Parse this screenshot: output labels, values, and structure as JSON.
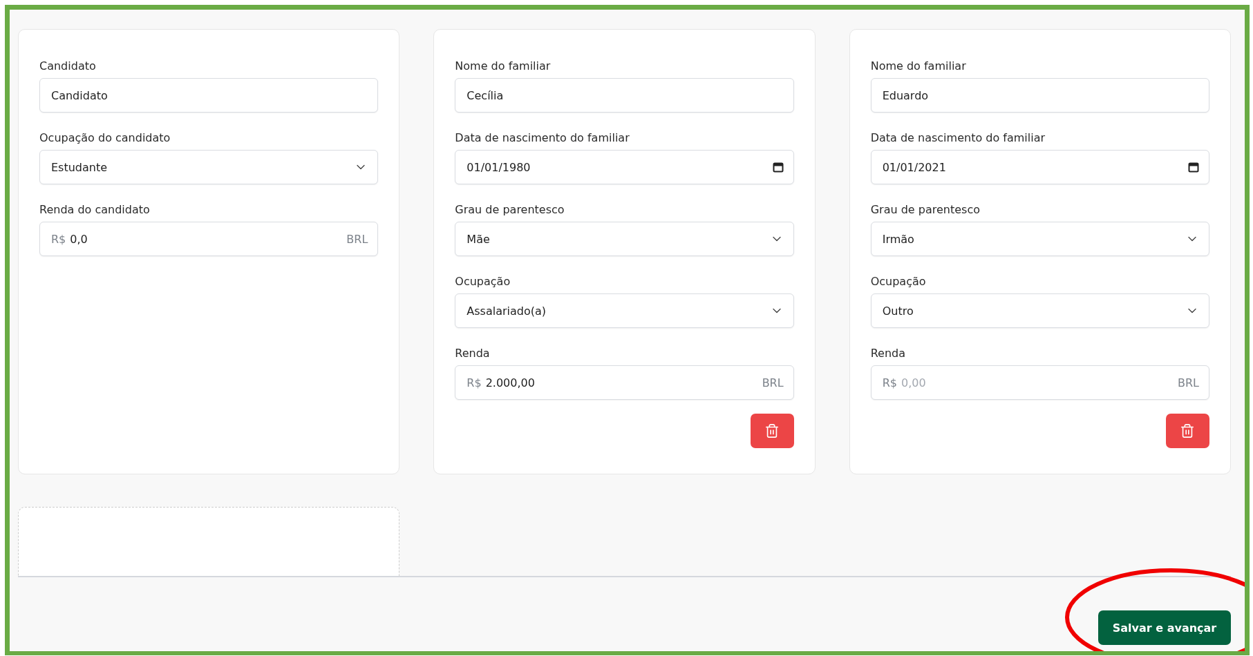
{
  "cards": [
    {
      "fields": [
        {
          "kind": "text",
          "label": "Candidato",
          "value": "Candidato"
        },
        {
          "kind": "select",
          "label": "Ocupação do candidato",
          "value": "Estudante"
        },
        {
          "kind": "money",
          "label": "Renda do candidato",
          "prefix": "R$",
          "value": "0,0",
          "suffix": "BRL"
        }
      ],
      "delete_button": false
    },
    {
      "fields": [
        {
          "kind": "text",
          "label": "Nome do familiar",
          "value": "Cecília"
        },
        {
          "kind": "date",
          "label": "Data de nascimento do familiar",
          "value": "01/01/1980"
        },
        {
          "kind": "select",
          "label": "Grau de parentesco",
          "value": "Mãe"
        },
        {
          "kind": "select",
          "label": "Ocupação",
          "value": "Assalariado(a)"
        },
        {
          "kind": "money",
          "label": "Renda",
          "prefix": "R$",
          "value": "2.000,00",
          "suffix": "BRL"
        }
      ],
      "delete_button": true
    },
    {
      "fields": [
        {
          "kind": "text",
          "label": "Nome do familiar",
          "value": "Eduardo"
        },
        {
          "kind": "date",
          "label": "Data de nascimento do familiar",
          "value": "01/01/2021"
        },
        {
          "kind": "select",
          "label": "Grau de parentesco",
          "value": "Irmão"
        },
        {
          "kind": "select",
          "label": "Ocupação",
          "value": "Outro"
        },
        {
          "kind": "money",
          "label": "Renda",
          "prefix": "R$",
          "placeholder": "0,00",
          "suffix": "BRL"
        }
      ],
      "delete_button": true
    }
  ],
  "submit_button": "Salvar e avançar"
}
